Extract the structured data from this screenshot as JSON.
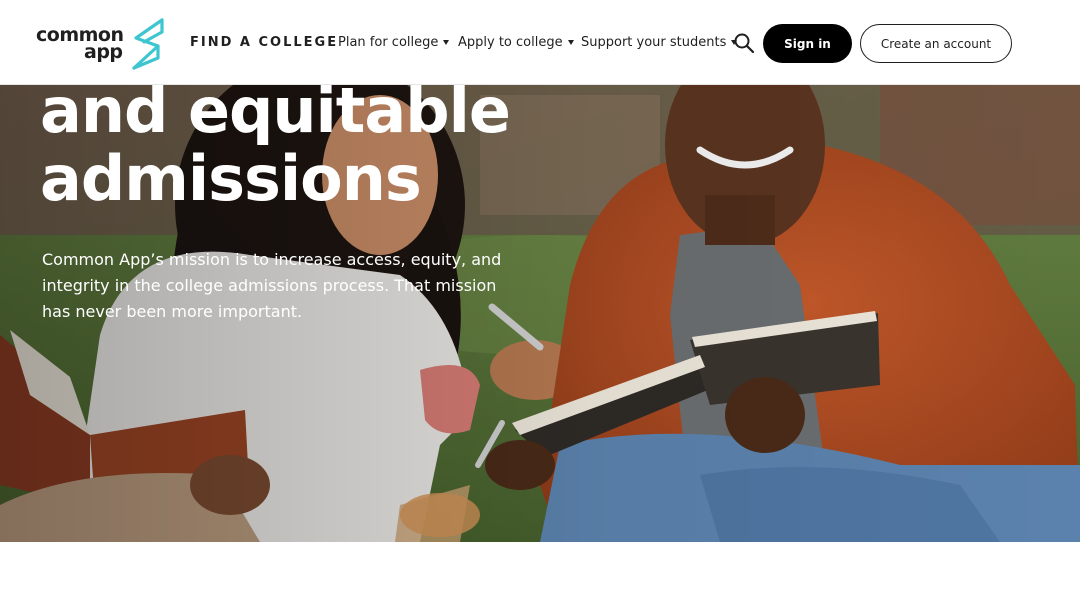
{
  "header": {
    "logo": {
      "line1": "common",
      "line2": "app"
    },
    "nav": {
      "find_college": "FIND A COLLEGE",
      "plan": "Plan for college",
      "apply": "Apply to college",
      "support": "Support your students"
    },
    "search_icon": "search-icon",
    "sign_in": "Sign in",
    "create_account": "Create an account"
  },
  "hero": {
    "title": "and equitable\nadmissions",
    "text": "Common App’s mission is to increase access, equity, and integrity in the college admissions process. That mission has never been more important."
  },
  "colors": {
    "brand_teal": "#3ec6d0",
    "text_dark": "#1f1f1f",
    "button_dark": "#000000",
    "white": "#ffffff"
  }
}
